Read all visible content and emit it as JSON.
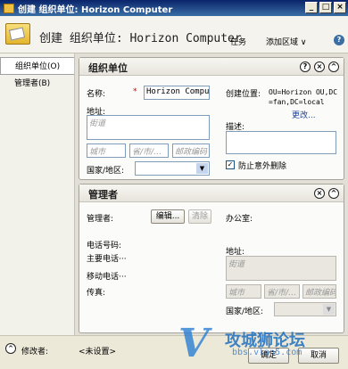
{
  "window": {
    "title": "创建 组织单位: Horizon Computer",
    "min": "_",
    "max": "□",
    "close": "×"
  },
  "header": {
    "title": "创建 组织单位: Horizon Computer",
    "tasks": "任务",
    "add_section": "添加区域 ∨",
    "help": "?"
  },
  "nav": {
    "items": [
      {
        "label": "组织单位(O)"
      },
      {
        "label": "管理者(B)"
      }
    ]
  },
  "ou_panel": {
    "title": "组织单位",
    "name_label": "名称:",
    "required_mark": "*",
    "name_value": "Horizon Computer",
    "address_label": "地址:",
    "street_placeholder": "街道",
    "city_placeholder": "城市",
    "state_placeholder": "省/市/…",
    "zip_placeholder": "邮政编码",
    "country_label": "国家/地区:",
    "location_label": "创建位置:",
    "location_value": "OU=Horizon OU,DC=fan,DC=local",
    "change_link": "更改...",
    "description_label": "描述:",
    "protect_label": "防止意外删除",
    "protect_checked": true
  },
  "manager_panel": {
    "title": "管理者",
    "manager_label": "管理者:",
    "edit_button": "编辑...",
    "clear_button": "清除",
    "office_label": "办公室:",
    "phone_label": "电话号码:",
    "main_phone_label": "主要电话···",
    "mobile_label": "移动电话···",
    "fax_label": "传真:",
    "address_label": "地址:",
    "street_placeholder": "街道",
    "city_placeholder": "城市",
    "state_placeholder": "省/市/…",
    "zip_placeholder": "邮政编码",
    "country_label": "国家/地区:"
  },
  "footer": {
    "modified_by_label": "修改者:",
    "modified_by_value": "<未设置>",
    "ok": "确定",
    "cancel": "取消"
  },
  "watermark": {
    "logo": "V",
    "text": "攻城狮论坛",
    "url": "bbs.vlan5.com"
  }
}
